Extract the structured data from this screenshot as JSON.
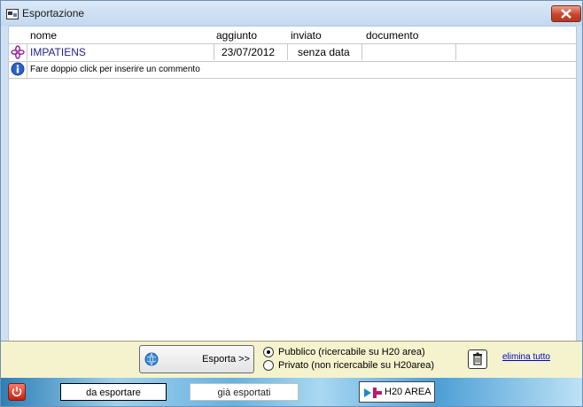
{
  "window": {
    "title": "Esportazione"
  },
  "table": {
    "columns": [
      "nome",
      "aggiunto",
      "inviato",
      "documento"
    ],
    "rows": [
      {
        "nome": "IMPATIENS",
        "aggiunto": "23/07/2012",
        "inviato": "senza data",
        "documento": ""
      }
    ],
    "comment_hint": "Fare doppio click per inserire un commento"
  },
  "actions": {
    "export_label": "Esporta >>",
    "visibility_options": [
      "Pubblico (ricercabile su H20 area)",
      "Privato (non ricercabile su H20area)"
    ],
    "selected_visibility": "Pubblico (ricercabile su H20 area)",
    "delete_all_label": "elimina tutto"
  },
  "footer": {
    "tabs": [
      "da esportare",
      "già esportati"
    ],
    "h2o_label": "H20 AREA"
  },
  "colors": {
    "title_bar": "#c9dcf1",
    "panel": "#f5f3cd",
    "link": "#0000cc",
    "name_text": "#1f1f8c"
  }
}
